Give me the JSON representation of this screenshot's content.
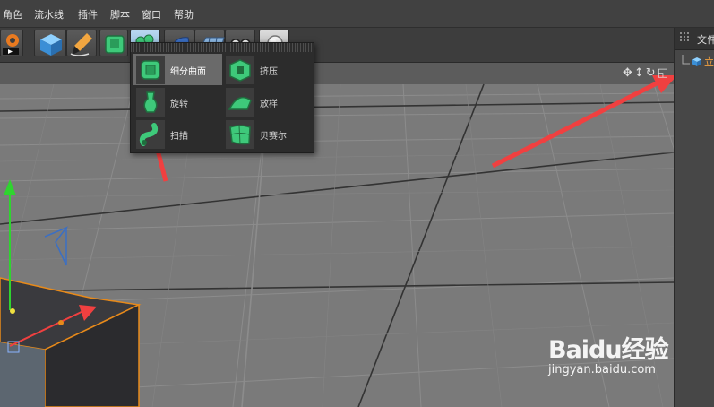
{
  "menubar": {
    "items": [
      "角色",
      "流水线",
      "插件",
      "脚本",
      "窗口",
      "帮助"
    ]
  },
  "toolbar": {
    "buttons": [
      "render-icon",
      "cube-icon",
      "pen-icon",
      "subdivision-icon",
      "generator-icon",
      "deformer-icon",
      "floor-icon",
      "camera-icon",
      "light-icon"
    ]
  },
  "popup": {
    "items": [
      {
        "label": "细分曲面",
        "icon": "subdivision-surface-icon",
        "highlighted": true
      },
      {
        "label": "挤压",
        "icon": "extrude-icon",
        "highlighted": false
      },
      {
        "label": "旋转",
        "icon": "lathe-icon",
        "highlighted": false
      },
      {
        "label": "放样",
        "icon": "loft-icon",
        "highlighted": false
      },
      {
        "label": "扫描",
        "icon": "sweep-icon",
        "highlighted": false
      },
      {
        "label": "贝赛尔",
        "icon": "bezier-icon",
        "highlighted": false
      }
    ]
  },
  "right_panel": {
    "header_label": "文件",
    "tree_item_label": "立"
  },
  "viewport": {
    "nav_icons": [
      "move-view-icon",
      "dolly-view-icon",
      "rotate-view-icon",
      "maximize-view-icon"
    ]
  },
  "watermark": {
    "brand": "Baidu经验",
    "url": "jingyan.baidu.com"
  },
  "colors": {
    "accent_red": "#f04040",
    "highlight_orange": "#e88a1a",
    "generator_green": "#3ec97a",
    "axis_green": "#2fd42f"
  }
}
